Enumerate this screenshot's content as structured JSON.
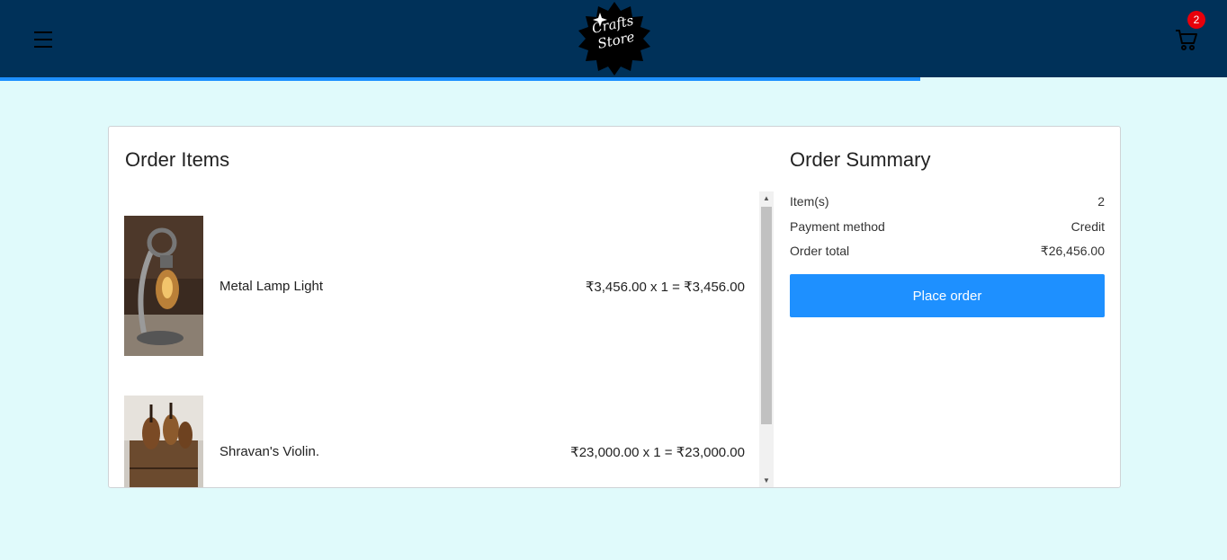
{
  "header": {
    "logo_line1": "Crafts",
    "logo_line2": "Store",
    "cart_count": "2",
    "progress_fraction": 0.75,
    "colors": {
      "header_bg": "#003159",
      "accent": "#1e90ff",
      "badge": "#e8000b"
    }
  },
  "order_items": {
    "title": "Order Items",
    "items": [
      {
        "name": "Metal Lamp Light",
        "price_line": "₹3,456.00 x 1 = ₹3,456.00",
        "image": "lamp-image"
      },
      {
        "name": "Shravan's Violin.",
        "price_line": "₹23,000.00 x 1 = ₹23,000.00",
        "image": "violin-image"
      }
    ]
  },
  "order_summary": {
    "title": "Order Summary",
    "rows": [
      {
        "label": "Item(s)",
        "value": "2"
      },
      {
        "label": "Payment method",
        "value": "Credit"
      },
      {
        "label": "Order total",
        "value": "₹26,456.00"
      }
    ],
    "button_label": "Place order"
  },
  "icons": {
    "menu": "hamburger-menu-icon",
    "cart": "shopping-cart-icon"
  }
}
